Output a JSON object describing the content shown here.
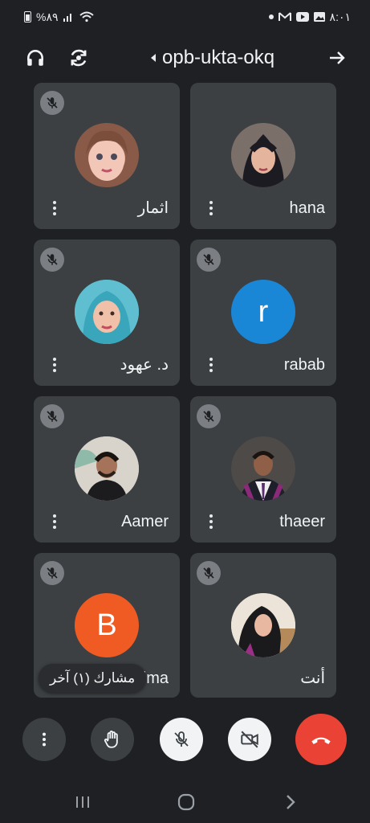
{
  "status_bar": {
    "battery": "%٨٩",
    "time": "٨:٠١"
  },
  "header": {
    "meeting_code": "opb-ukta-okq"
  },
  "participants": [
    {
      "name": "hana",
      "avatar": "photo",
      "avatar_color": "#6a5d56"
    },
    {
      "name": "اثمار",
      "avatar": "photo",
      "avatar_color": "#d9a592"
    },
    {
      "name": "rabab",
      "avatar": "letter",
      "initial": "r",
      "avatar_color": "#1a87d6"
    },
    {
      "name": "د. عهود",
      "avatar": "photo",
      "avatar_color": "#4cb2c6"
    },
    {
      "name": "thaeer",
      "avatar": "photo",
      "avatar_color": "#3a3a3c"
    },
    {
      "name": "Aamer",
      "avatar": "photo",
      "avatar_color": "#c9c6c0"
    },
    {
      "name": "أنت",
      "avatar": "photo",
      "avatar_color": "#e6ddd2"
    },
    {
      "name": "Basima",
      "avatar": "letter",
      "initial": "B",
      "avatar_color": "#ef5b23"
    }
  ],
  "others_chip": "مشارك (١) آخر",
  "controls": [
    "more-options",
    "raise-hand",
    "microphone-off",
    "camera-off",
    "end-call"
  ],
  "colors": {
    "background": "#1f2023",
    "tile": "#3c4043",
    "end_call": "#ea4335"
  }
}
